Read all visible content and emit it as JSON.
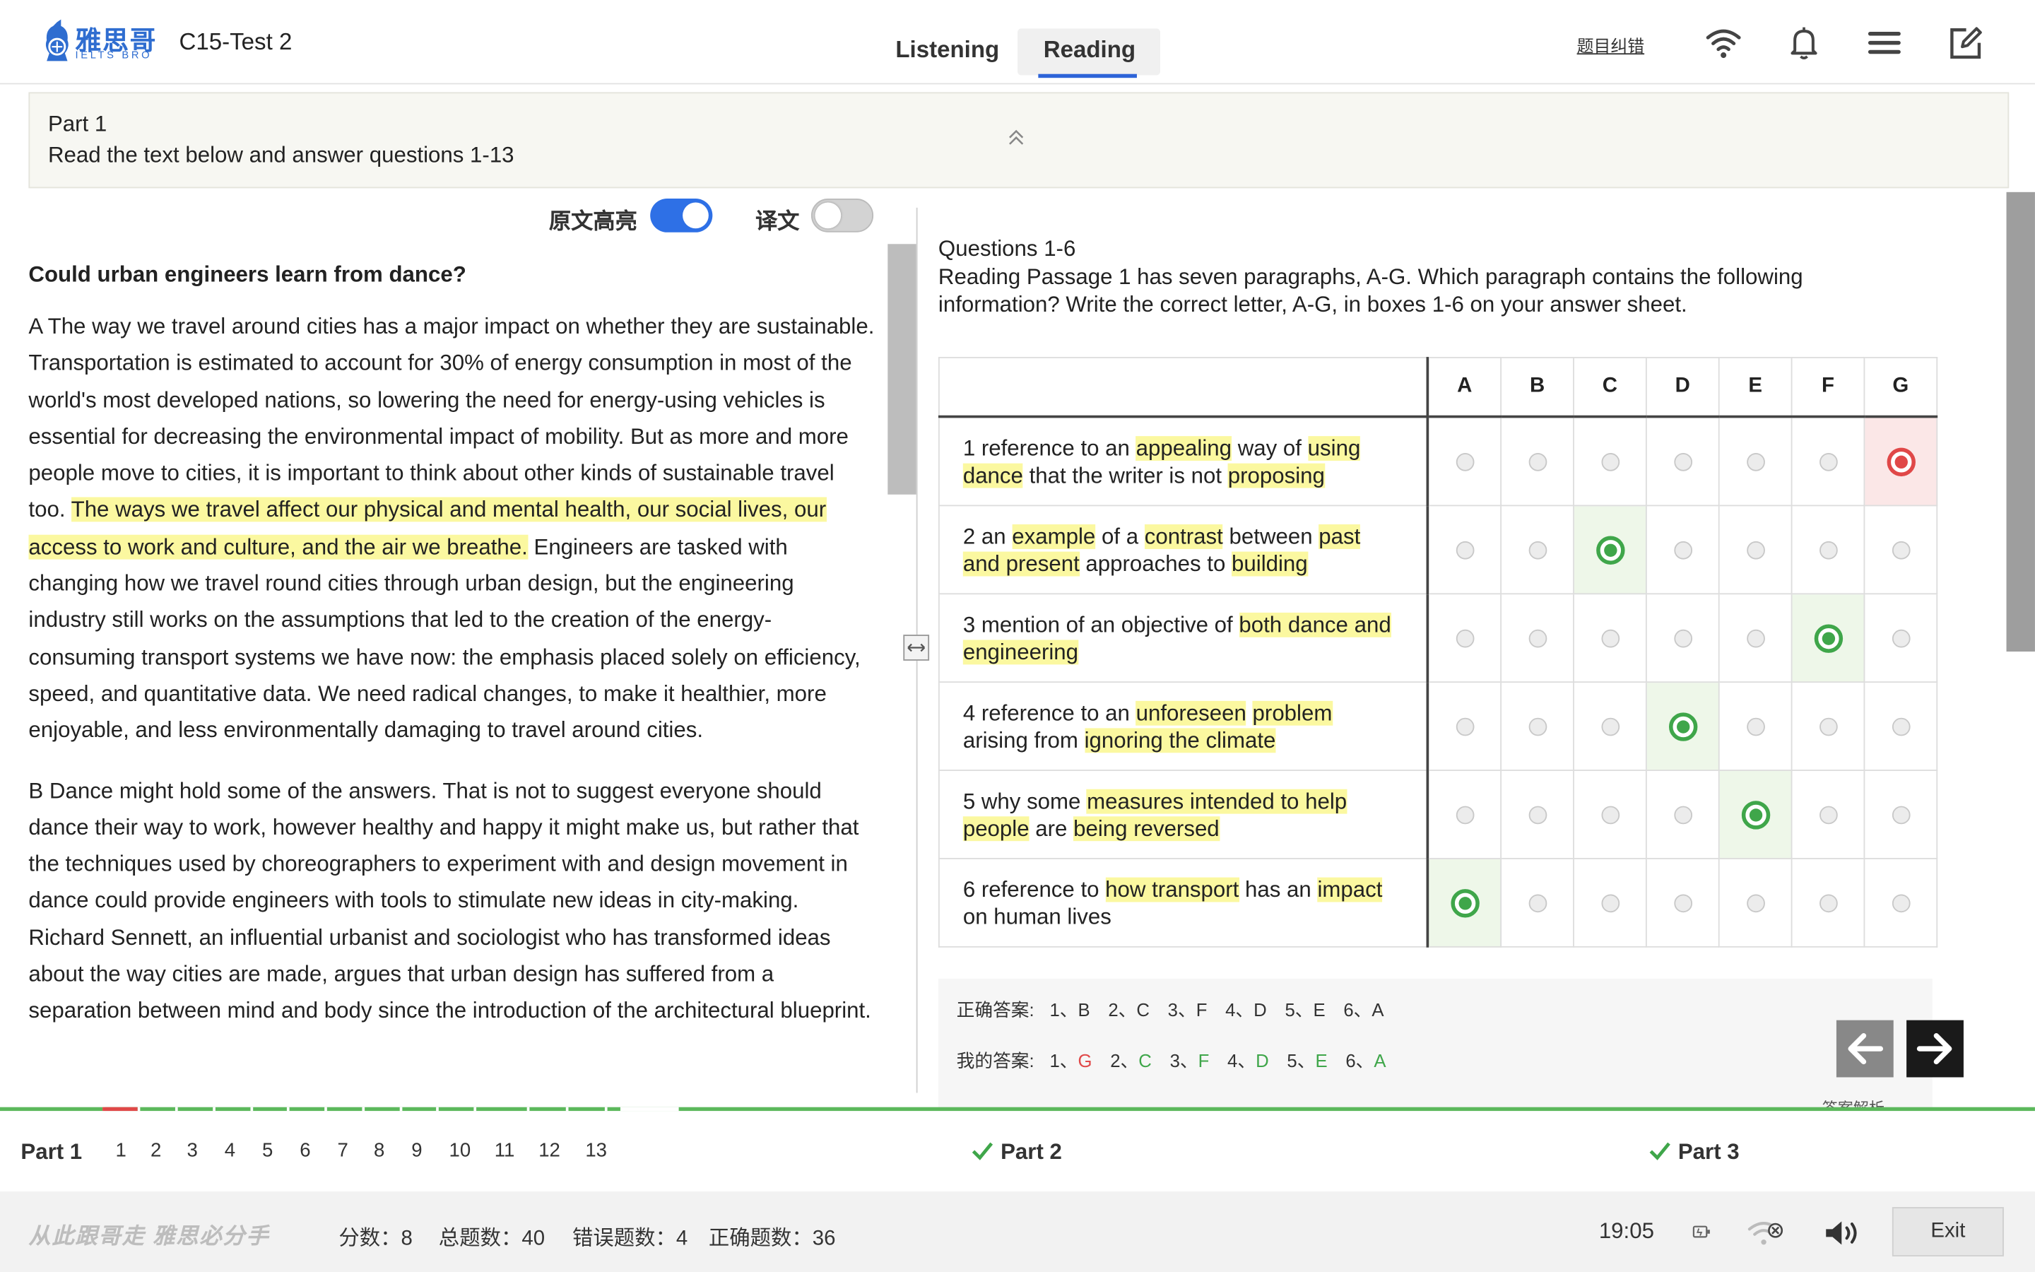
{
  "header": {
    "logo_cn": "雅思哥",
    "logo_en": "IELTS BRO",
    "test_title": "C15-Test 2",
    "tabs": [
      {
        "label": "Listening"
      },
      {
        "label": "Reading"
      }
    ],
    "active_tab": "Reading",
    "report_link": "题目纠错",
    "icons": [
      "wifi-icon",
      "bell-icon",
      "menu-icon",
      "edit-icon"
    ]
  },
  "part_banner": {
    "title": "Part 1",
    "instruction": "Read the text below and answer questions 1-13"
  },
  "toggles": [
    {
      "label": "原文高亮",
      "state": "on"
    },
    {
      "label": "译文",
      "state": "off"
    }
  ],
  "passage": {
    "title": "Could urban engineers learn from dance?",
    "paragraphs": [
      {
        "before": "A  The way we travel around cities has a major impact on whether they are sustainable. Transportation is estimated to account for 30% of energy consumption in most of the world's most developed nations, so lowering the need for energy-using vehicles is essential for decreasing the environmental impact of mobility. But as more and more people move to cities, it is important to think about other kinds of sustainable travel too. ",
        "highlight": "The ways we travel affect our physical and mental health, our social lives, our access to work and culture, and the air we breathe.",
        "after": " Engineers are tasked with changing how we travel round cities through urban design, but the engineering industry still works on the assumptions that led to the creation of the energy-consuming transport systems we have now: the emphasis placed solely on efficiency, speed, and quantitative data. We need radical changes, to make it healthier, more enjoyable, and less environmentally damaging to travel around cities."
      },
      {
        "text": "B  Dance might hold some of the answers. That is not to suggest everyone should dance their way to work, however healthy and happy it might make us, but rather that the techniques used by choreographers to experiment with and design movement in dance could provide engineers with tools to stimulate new ideas in city-making. Richard Sennett, an influential urbanist and sociologist who has transformed ideas about the way cities are made, argues that urban design has suffered from a separation between mind and body since the introduction of the architectural blueprint."
      }
    ]
  },
  "questions": {
    "title": "Questions 1-6",
    "instruction": "Reading Passage 1 has seven paragraphs, A-G. Which paragraph contains the following information? Write the correct letter, A-G, in boxes 1-6 on your answer sheet.",
    "columns": [
      "A",
      "B",
      "C",
      "D",
      "E",
      "F",
      "G"
    ],
    "rows": [
      {
        "segments": [
          [
            "1 reference to an ",
            false
          ],
          [
            "appealing",
            true
          ],
          [
            " way of ",
            false
          ],
          [
            "using dance",
            true
          ],
          [
            " that the writer is not ",
            false
          ],
          [
            "proposing",
            true
          ]
        ],
        "selected": 6,
        "status": "wrong"
      },
      {
        "segments": [
          [
            "2 an ",
            false
          ],
          [
            "example",
            true
          ],
          [
            " of a ",
            false
          ],
          [
            "contrast",
            true
          ],
          [
            " between ",
            false
          ],
          [
            "past and present",
            true
          ],
          [
            " approaches to ",
            false
          ],
          [
            "building",
            true
          ]
        ],
        "selected": 2,
        "status": "correct"
      },
      {
        "segments": [
          [
            "3 mention of an objective of ",
            false
          ],
          [
            "both dance and engineering",
            true
          ]
        ],
        "selected": 5,
        "status": "correct"
      },
      {
        "segments": [
          [
            "4 reference to an ",
            false
          ],
          [
            "unforeseen",
            true
          ],
          [
            " ",
            false
          ],
          [
            "problem",
            true
          ],
          [
            " arising from ",
            false
          ],
          [
            "ignoring the climate",
            true
          ]
        ],
        "selected": 3,
        "status": "correct"
      },
      {
        "segments": [
          [
            "5 why some ",
            false
          ],
          [
            "measures intended to help people",
            true
          ],
          [
            " are ",
            false
          ],
          [
            "being reversed",
            true
          ]
        ],
        "selected": 4,
        "status": "correct"
      },
      {
        "segments": [
          [
            "6 reference to ",
            false
          ],
          [
            "how transport",
            true
          ],
          [
            " has an ",
            false
          ],
          [
            "impact",
            true
          ],
          [
            " on human lives",
            false
          ]
        ],
        "selected": 0,
        "status": "correct"
      }
    ]
  },
  "answers": {
    "correct_label": "正确答案:",
    "correct": [
      "1、B",
      "2、C",
      "3、F",
      "4、D",
      "5、E",
      "6、A"
    ],
    "mine_label": "我的答案:",
    "mine": [
      {
        "num": "1、",
        "ans": "G",
        "status": "wrong"
      },
      {
        "num": "2、",
        "ans": "C",
        "status": "correct"
      },
      {
        "num": "3、",
        "ans": "F",
        "status": "correct"
      },
      {
        "num": "4、",
        "ans": "D",
        "status": "correct"
      },
      {
        "num": "5、",
        "ans": "E",
        "status": "correct"
      },
      {
        "num": "6、",
        "ans": "A",
        "status": "correct"
      }
    ],
    "peek_text": "答案解析"
  },
  "part_nav": {
    "part1_label": "Part 1",
    "question_numbers": [
      "1",
      "2",
      "3",
      "4",
      "5",
      "6",
      "7",
      "8",
      "9",
      "10",
      "11",
      "12",
      "13"
    ],
    "part2_label": "Part 2",
    "part3_label": "Part 3"
  },
  "bottom_bar": {
    "slogan": "从此跟哥走 雅思必分手",
    "score": "分数：8",
    "total": "总题数：40",
    "wrong": "错误题数：4",
    "right": "正确题数：36",
    "time": "19:05",
    "exit_label": "Exit"
  },
  "colors": {
    "accent_blue": "#2e70e6",
    "correct_green": "#3fa64a",
    "wrong_red": "#e04848",
    "highlight_yellow": "#fbf8a0"
  }
}
